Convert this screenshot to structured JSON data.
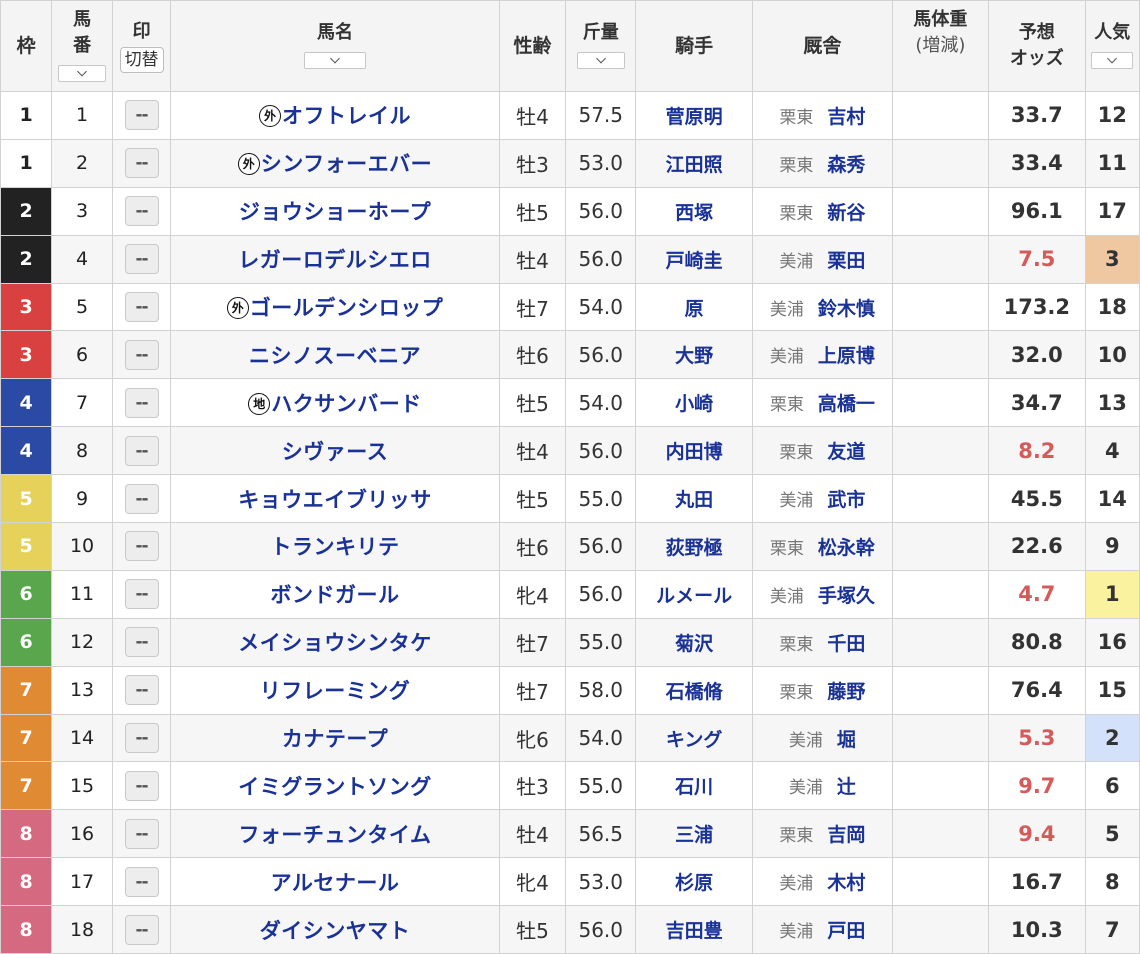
{
  "header": {
    "waku": "枠",
    "umaban_top": "馬",
    "umaban_bottom": "番",
    "mark": "印",
    "switch": "切替",
    "horse_name": "馬名",
    "sex_age": "性齢",
    "weight": "斤量",
    "jockey": "騎手",
    "stable": "厩舎",
    "body_weight": "馬体重",
    "body_weight_sub": "(増減)",
    "odds_top": "予想",
    "odds_bottom": "オッズ",
    "popularity": "人気"
  },
  "mark_placeholder": "--",
  "waku_colors": {
    "1": "#ffffff",
    "2": "#222222",
    "3": "#d94040",
    "4": "#2a4aa5",
    "5": "#e6d25a",
    "6": "#5aa64c",
    "7": "#e08a34",
    "8": "#d4697f"
  },
  "waku_text_colors": {
    "1": "#222222"
  },
  "popularity_highlight": {
    "1": "#fbf2a0",
    "2": "#d4e1fb",
    "3": "#efc7a1"
  },
  "rows": [
    {
      "waku": "1",
      "umaban": "1",
      "badge": "外",
      "name": "オフトレイル",
      "sexage": "牡4",
      "weight": "57.5",
      "jockey": "菅原明",
      "region": "栗東",
      "trainer": "吉村",
      "odds": "33.7",
      "pop": "12"
    },
    {
      "waku": "1",
      "umaban": "2",
      "badge": "外",
      "name": "シンフォーエバー",
      "sexage": "牡3",
      "weight": "53.0",
      "jockey": "江田照",
      "region": "栗東",
      "trainer": "森秀",
      "odds": "33.4",
      "pop": "11"
    },
    {
      "waku": "2",
      "umaban": "3",
      "badge": "",
      "name": "ジョウショーホープ",
      "sexage": "牡5",
      "weight": "56.0",
      "jockey": "西塚",
      "region": "栗東",
      "trainer": "新谷",
      "odds": "96.1",
      "pop": "17"
    },
    {
      "waku": "2",
      "umaban": "4",
      "badge": "",
      "name": "レガーロデルシエロ",
      "sexage": "牡4",
      "weight": "56.0",
      "jockey": "戸崎圭",
      "region": "美浦",
      "trainer": "栗田",
      "odds": "7.5",
      "pop": "3"
    },
    {
      "waku": "3",
      "umaban": "5",
      "badge": "外",
      "name": "ゴールデンシロップ",
      "sexage": "牡7",
      "weight": "54.0",
      "jockey": "原",
      "region": "美浦",
      "trainer": "鈴木慎",
      "odds": "173.2",
      "pop": "18"
    },
    {
      "waku": "3",
      "umaban": "6",
      "badge": "",
      "name": "ニシノスーベニア",
      "sexage": "牡6",
      "weight": "56.0",
      "jockey": "大野",
      "region": "美浦",
      "trainer": "上原博",
      "odds": "32.0",
      "pop": "10"
    },
    {
      "waku": "4",
      "umaban": "7",
      "badge": "地",
      "name": "ハクサンバード",
      "sexage": "牡5",
      "weight": "54.0",
      "jockey": "小崎",
      "region": "栗東",
      "trainer": "高橋一",
      "odds": "34.7",
      "pop": "13"
    },
    {
      "waku": "4",
      "umaban": "8",
      "badge": "",
      "name": "シヴァース",
      "sexage": "牡4",
      "weight": "56.0",
      "jockey": "内田博",
      "region": "栗東",
      "trainer": "友道",
      "odds": "8.2",
      "pop": "4"
    },
    {
      "waku": "5",
      "umaban": "9",
      "badge": "",
      "name": "キョウエイブリッサ",
      "sexage": "牡5",
      "weight": "55.0",
      "jockey": "丸田",
      "region": "美浦",
      "trainer": "武市",
      "odds": "45.5",
      "pop": "14"
    },
    {
      "waku": "5",
      "umaban": "10",
      "badge": "",
      "name": "トランキリテ",
      "sexage": "牡6",
      "weight": "56.0",
      "jockey": "荻野極",
      "region": "栗東",
      "trainer": "松永幹",
      "odds": "22.6",
      "pop": "9"
    },
    {
      "waku": "6",
      "umaban": "11",
      "badge": "",
      "name": "ボンドガール",
      "sexage": "牝4",
      "weight": "56.0",
      "jockey": "ルメール",
      "region": "美浦",
      "trainer": "手塚久",
      "odds": "4.7",
      "pop": "1"
    },
    {
      "waku": "6",
      "umaban": "12",
      "badge": "",
      "name": "メイショウシンタケ",
      "sexage": "牡7",
      "weight": "55.0",
      "jockey": "菊沢",
      "region": "栗東",
      "trainer": "千田",
      "odds": "80.8",
      "pop": "16"
    },
    {
      "waku": "7",
      "umaban": "13",
      "badge": "",
      "name": "リフレーミング",
      "sexage": "牡7",
      "weight": "58.0",
      "jockey": "石橋脩",
      "region": "栗東",
      "trainer": "藤野",
      "odds": "76.4",
      "pop": "15"
    },
    {
      "waku": "7",
      "umaban": "14",
      "badge": "",
      "name": "カナテープ",
      "sexage": "牝6",
      "weight": "54.0",
      "jockey": "キング",
      "region": "美浦",
      "trainer": "堀",
      "odds": "5.3",
      "pop": "2"
    },
    {
      "waku": "7",
      "umaban": "15",
      "badge": "",
      "name": "イミグラントソング",
      "sexage": "牡3",
      "weight": "55.0",
      "jockey": "石川",
      "region": "美浦",
      "trainer": "辻",
      "odds": "9.7",
      "pop": "6"
    },
    {
      "waku": "8",
      "umaban": "16",
      "badge": "",
      "name": "フォーチュンタイム",
      "sexage": "牡4",
      "weight": "56.5",
      "jockey": "三浦",
      "region": "栗東",
      "trainer": "吉岡",
      "odds": "9.4",
      "pop": "5"
    },
    {
      "waku": "8",
      "umaban": "17",
      "badge": "",
      "name": "アルセナール",
      "sexage": "牝4",
      "weight": "53.0",
      "jockey": "杉原",
      "region": "美浦",
      "trainer": "木村",
      "odds": "16.7",
      "pop": "8"
    },
    {
      "waku": "8",
      "umaban": "18",
      "badge": "",
      "name": "ダイシンヤマト",
      "sexage": "牡5",
      "weight": "56.0",
      "jockey": "吉田豊",
      "region": "美浦",
      "trainer": "戸田",
      "odds": "10.3",
      "pop": "7"
    }
  ]
}
